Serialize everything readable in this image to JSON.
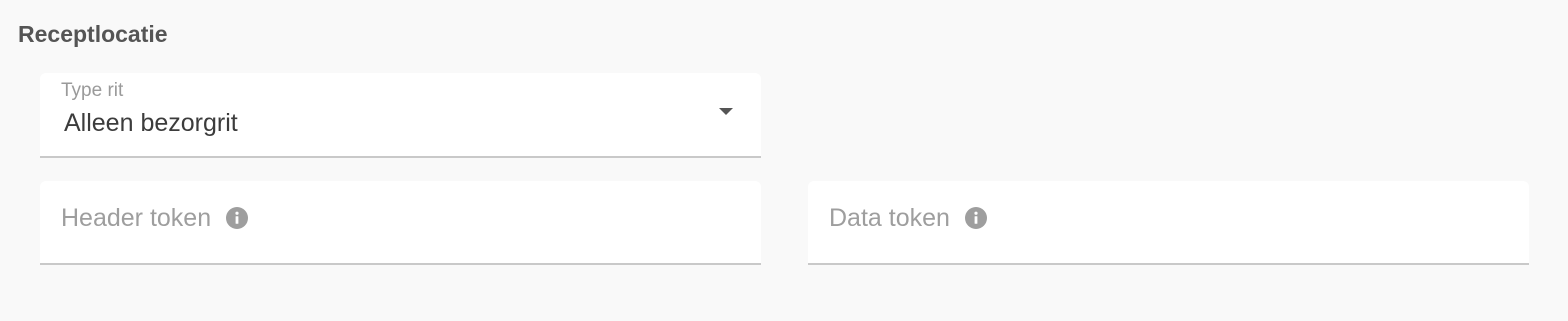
{
  "section": {
    "title": "Receptlocatie"
  },
  "trip_type": {
    "label": "Type rit",
    "value": "Alleen bezorgrit",
    "icon": "chevron-down-icon"
  },
  "header_token": {
    "placeholder": "Header token",
    "icon": "info-icon"
  },
  "data_token": {
    "placeholder": "Data token",
    "icon": "info-icon"
  },
  "colors": {
    "background": "#f9f9f9",
    "field_background": "#ffffff",
    "title": "#555555",
    "label": "#9a9a9a",
    "value": "#3c3c3c",
    "underline": "#c9c9c9",
    "icon": "#9e9e9e"
  }
}
